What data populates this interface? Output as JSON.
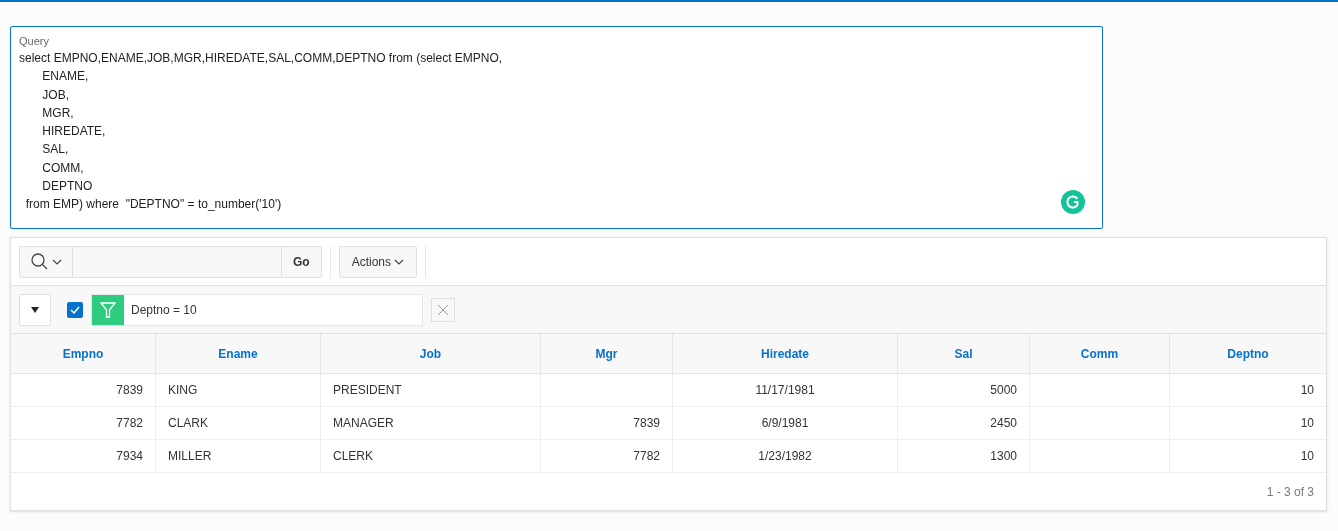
{
  "query": {
    "label": "Query",
    "value": "select EMPNO,ENAME,JOB,MGR,HIREDATE,SAL,COMM,DEPTNO from (select EMPNO,\n       ENAME,\n       JOB,\n       MGR,\n       HIREDATE,\n       SAL,\n       COMM,\n       DEPTNO\n  from EMP) where  \"DEPTNO\" = to_number('10')"
  },
  "toolbar": {
    "go": "Go",
    "actions": "Actions"
  },
  "filter": {
    "checked": true,
    "text": "Deptno = 10"
  },
  "table": {
    "columns": [
      "Empno",
      "Ename",
      "Job",
      "Mgr",
      "Hiredate",
      "Sal",
      "Comm",
      "Deptno"
    ],
    "rows": [
      [
        "7839",
        "KING",
        "PRESIDENT",
        "",
        "11/17/1981",
        "5000",
        "",
        "10"
      ],
      [
        "7782",
        "CLARK",
        "MANAGER",
        "7839",
        "6/9/1981",
        "2450",
        "",
        "10"
      ],
      [
        "7934",
        "MILLER",
        "CLERK",
        "7782",
        "1/23/1982",
        "1300",
        "",
        "10"
      ]
    ]
  },
  "pagination": "1 - 3 of 3"
}
